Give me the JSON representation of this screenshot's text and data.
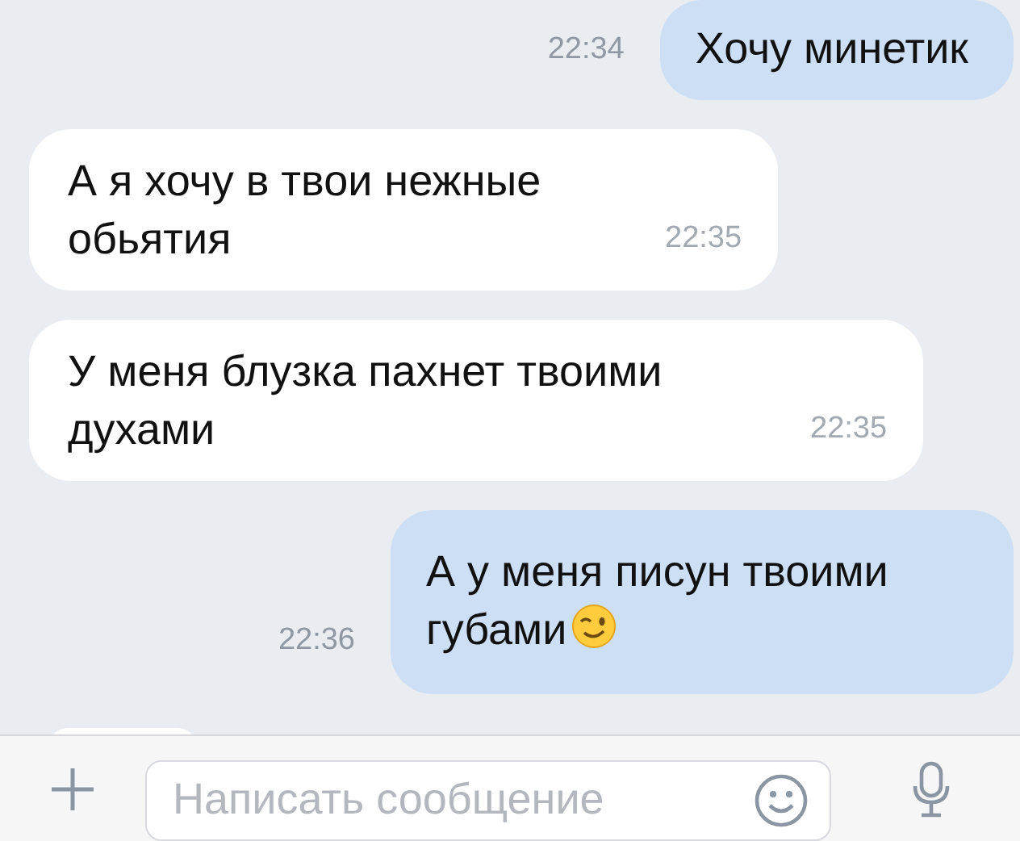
{
  "messages": [
    {
      "kind": "outgoing",
      "text": "Хочу минетик",
      "time": "22:34",
      "has_emoji": false
    },
    {
      "kind": "incoming",
      "text": "А я хочу в твои нежные обьятия",
      "time": "22:35",
      "has_emoji": false
    },
    {
      "kind": "incoming",
      "text": "У меня блузка пахнет твоими духами",
      "time": "22:35",
      "has_emoji": false
    },
    {
      "kind": "outgoing",
      "text": "А у меня писун твоими губами",
      "time": "22:36",
      "has_emoji": true
    }
  ],
  "composer": {
    "placeholder": "Написать сообщение"
  }
}
